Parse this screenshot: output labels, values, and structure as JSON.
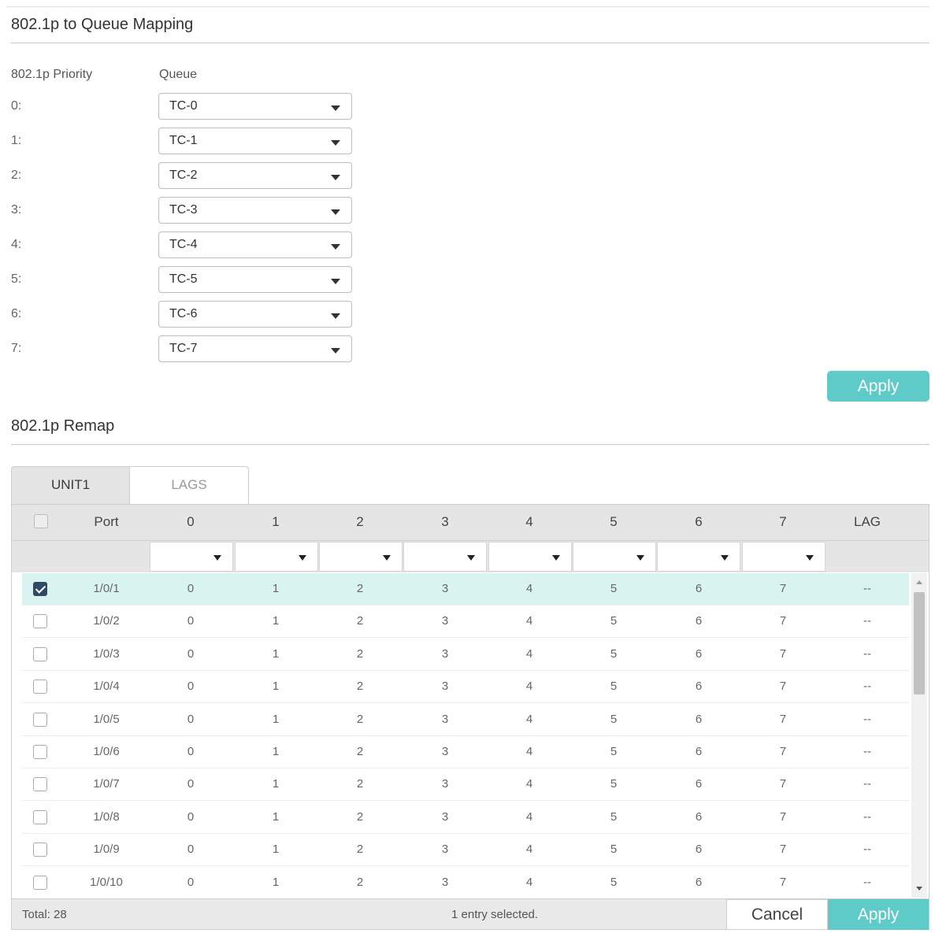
{
  "mapping": {
    "title": "802.1p to Queue Mapping",
    "priority_header": "802.1p Priority",
    "queue_header": "Queue",
    "rows": [
      {
        "priority": "0:",
        "queue": "TC-0"
      },
      {
        "priority": "1:",
        "queue": "TC-1"
      },
      {
        "priority": "2:",
        "queue": "TC-2"
      },
      {
        "priority": "3:",
        "queue": "TC-3"
      },
      {
        "priority": "4:",
        "queue": "TC-4"
      },
      {
        "priority": "5:",
        "queue": "TC-5"
      },
      {
        "priority": "6:",
        "queue": "TC-6"
      },
      {
        "priority": "7:",
        "queue": "TC-7"
      }
    ],
    "apply_label": "Apply"
  },
  "remap": {
    "title": "802.1p Remap",
    "tabs": [
      "UNIT1",
      "LAGS"
    ],
    "active_tab": "UNIT1",
    "columns": [
      "Port",
      "0",
      "1",
      "2",
      "3",
      "4",
      "5",
      "6",
      "7",
      "LAG"
    ],
    "rows": [
      {
        "checked": true,
        "cells": [
          "1/0/1",
          "0",
          "1",
          "2",
          "3",
          "4",
          "5",
          "6",
          "7",
          "--"
        ]
      },
      {
        "checked": false,
        "cells": [
          "1/0/2",
          "0",
          "1",
          "2",
          "3",
          "4",
          "5",
          "6",
          "7",
          "--"
        ]
      },
      {
        "checked": false,
        "cells": [
          "1/0/3",
          "0",
          "1",
          "2",
          "3",
          "4",
          "5",
          "6",
          "7",
          "--"
        ]
      },
      {
        "checked": false,
        "cells": [
          "1/0/4",
          "0",
          "1",
          "2",
          "3",
          "4",
          "5",
          "6",
          "7",
          "--"
        ]
      },
      {
        "checked": false,
        "cells": [
          "1/0/5",
          "0",
          "1",
          "2",
          "3",
          "4",
          "5",
          "6",
          "7",
          "--"
        ]
      },
      {
        "checked": false,
        "cells": [
          "1/0/6",
          "0",
          "1",
          "2",
          "3",
          "4",
          "5",
          "6",
          "7",
          "--"
        ]
      },
      {
        "checked": false,
        "cells": [
          "1/0/7",
          "0",
          "1",
          "2",
          "3",
          "4",
          "5",
          "6",
          "7",
          "--"
        ]
      },
      {
        "checked": false,
        "cells": [
          "1/0/8",
          "0",
          "1",
          "2",
          "3",
          "4",
          "5",
          "6",
          "7",
          "--"
        ]
      },
      {
        "checked": false,
        "cells": [
          "1/0/9",
          "0",
          "1",
          "2",
          "3",
          "4",
          "5",
          "6",
          "7",
          "--"
        ]
      },
      {
        "checked": false,
        "cells": [
          "1/0/10",
          "0",
          "1",
          "2",
          "3",
          "4",
          "5",
          "6",
          "7",
          "--"
        ]
      }
    ],
    "total": "Total: 28",
    "selected_info": "1 entry selected.",
    "cancel_label": "Cancel",
    "apply_label": "Apply"
  },
  "colors": {
    "accent": "#5ecbc8",
    "selected_row": "#d9f3f1",
    "checkbox_checked": "#2f4a63"
  }
}
